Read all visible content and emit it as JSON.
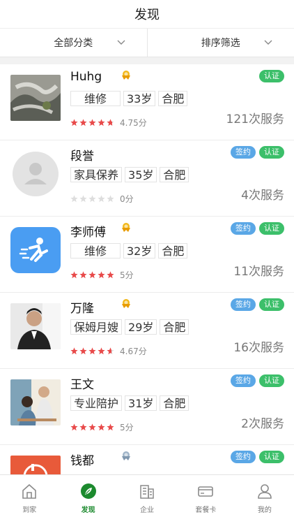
{
  "header": {
    "title": "发现"
  },
  "filters": {
    "category_label": "全部分类",
    "sort_label": "排序筛选"
  },
  "workers": [
    {
      "name": "Huhg",
      "category": "维修",
      "age": "33岁",
      "city": "合肥",
      "rating": 4.75,
      "rating_text": "4.75分",
      "services": "121次服务",
      "signed": false,
      "certified": true,
      "medal": "gold"
    },
    {
      "name": "段誉",
      "category": "家具保养",
      "age": "35岁",
      "city": "合肥",
      "rating": 0,
      "rating_text": "0分",
      "services": "4次服务",
      "signed": true,
      "certified": true,
      "medal": "none"
    },
    {
      "name": "李师傅",
      "category": "维修",
      "age": "32岁",
      "city": "合肥",
      "rating": 5,
      "rating_text": "5分",
      "services": "11次服务",
      "signed": true,
      "certified": true,
      "medal": "gold"
    },
    {
      "name": "万隆",
      "category": "保姆月嫂",
      "age": "29岁",
      "city": "合肥",
      "rating": 4.67,
      "rating_text": "4.67分",
      "services": "16次服务",
      "signed": true,
      "certified": true,
      "medal": "gold"
    },
    {
      "name": "王文",
      "category": "专业陪护",
      "age": "31岁",
      "city": "合肥",
      "rating": 5,
      "rating_text": "5分",
      "services": "2次服务",
      "signed": true,
      "certified": true,
      "medal": "none"
    },
    {
      "name": "钱都",
      "category": "",
      "age": "",
      "city": "",
      "rating": 0,
      "rating_text": "",
      "services": "",
      "signed": true,
      "certified": true,
      "medal": "silver"
    }
  ],
  "badge_labels": {
    "signed": "签约",
    "certified": "认证"
  },
  "tabs": [
    {
      "label": "到家",
      "icon": "home-icon",
      "active": false
    },
    {
      "label": "发现",
      "icon": "discover-icon",
      "active": true
    },
    {
      "label": "企业",
      "icon": "building-icon",
      "active": false
    },
    {
      "label": "套餐卡",
      "icon": "card-icon",
      "active": false
    },
    {
      "label": "我的",
      "icon": "user-icon",
      "active": false
    }
  ],
  "colors": {
    "accent_green": "#1c8a2e",
    "signed_blue": "#5aa7e6",
    "certified_green": "#3cbf6a",
    "star_red": "#e84a4a",
    "star_gray": "#dddddd"
  }
}
